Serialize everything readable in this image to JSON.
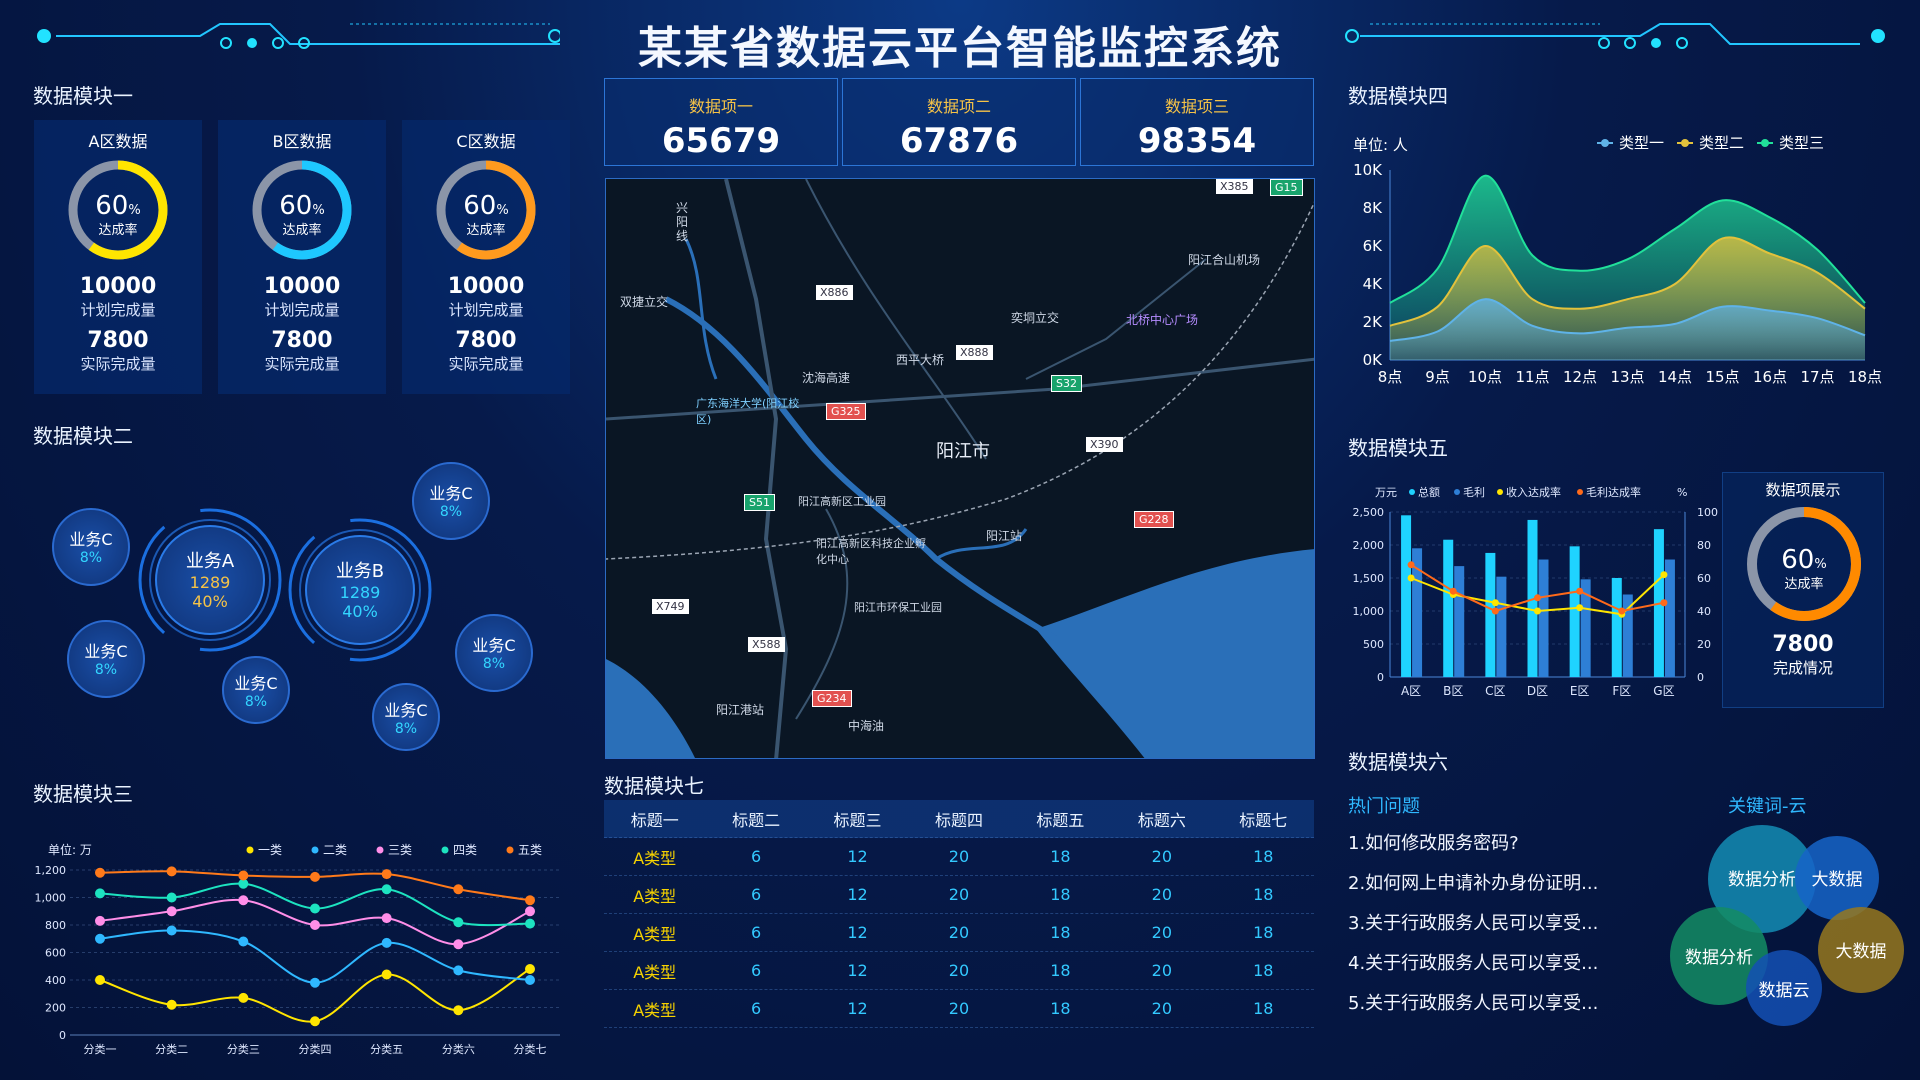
{
  "header": {
    "title": "某某省数据云平台智能监控系统",
    "kpis": [
      {
        "label": "数据项一",
        "value": "65679"
      },
      {
        "label": "数据项二",
        "value": "67876"
      },
      {
        "label": "数据项三",
        "value": "98354"
      }
    ]
  },
  "module1": {
    "title": "数据模块一",
    "cards": [
      {
        "title": "A区数据",
        "pct": "60",
        "pct_unit": "%",
        "rate_label": "达成率",
        "plan": "10000",
        "plan_label": "计划完成量",
        "actual": "7800",
        "actual_label": "实际完成量",
        "color": "#ffe500",
        "fraction": 0.6
      },
      {
        "title": "B区数据",
        "pct": "60",
        "pct_unit": "%",
        "rate_label": "达成率",
        "plan": "10000",
        "plan_label": "计划完成量",
        "actual": "7800",
        "actual_label": "实际完成量",
        "color": "#1ec8ff",
        "fraction": 0.6
      },
      {
        "title": "C区数据",
        "pct": "60",
        "pct_unit": "%",
        "rate_label": "达成率",
        "plan": "10000",
        "plan_label": "计划完成量",
        "actual": "7800",
        "actual_label": "实际完成量",
        "color": "#ff9a1e",
        "fraction": 0.6
      }
    ]
  },
  "module2": {
    "title": "数据模块二",
    "bubbles": [
      {
        "name": "业务A",
        "value": "1289",
        "pct": "40%",
        "pct_color": "#f6c347"
      },
      {
        "name": "业务B",
        "value": "1289",
        "pct": "40%",
        "pct_color": "#33d6ff"
      },
      {
        "name": "业务C",
        "pct": "8%"
      },
      {
        "name": "业务C",
        "pct": "8%"
      },
      {
        "name": "业务C",
        "pct": "8%"
      },
      {
        "name": "业务C",
        "pct": "8%"
      },
      {
        "name": "业务C",
        "pct": "8%"
      },
      {
        "name": "业务C",
        "pct": "8%"
      }
    ]
  },
  "module3": {
    "title": "数据模块三"
  },
  "module4": {
    "title": "数据模块四"
  },
  "module5": {
    "title": "数据模块五",
    "side_title": "数据项展示",
    "side_pct": "60",
    "side_pct_unit": "%",
    "side_rate_label": "达成率",
    "side_fraction": 0.6,
    "side_value": "7800",
    "side_value_label": "完成情况"
  },
  "module6": {
    "title": "数据模块六",
    "faq_title": "热门问题",
    "faqs": [
      "1.如何修改服务密码?",
      "2.如何网上申请补办身份证明...",
      "3.关于行政服务人民可以享受...",
      "4.关于行政服务人民可以享受...",
      "5.关于行政服务人民可以享受..."
    ],
    "keyword_title": "关键词-云",
    "keywords": [
      "数据分析",
      "大数据",
      "数据分析",
      "大数据",
      "数据云"
    ]
  },
  "module7": {
    "title": "数据模块七",
    "headers": [
      "标题一",
      "标题二",
      "标题三",
      "标题四",
      "标题五",
      "标题六",
      "标题七"
    ],
    "rows": [
      [
        "A类型",
        "6",
        "12",
        "20",
        "18",
        "20",
        "18"
      ],
      [
        "A类型",
        "6",
        "12",
        "20",
        "18",
        "20",
        "18"
      ],
      [
        "A类型",
        "6",
        "12",
        "20",
        "18",
        "20",
        "18"
      ],
      [
        "A类型",
        "6",
        "12",
        "20",
        "18",
        "20",
        "18"
      ],
      [
        "A类型",
        "6",
        "12",
        "20",
        "18",
        "20",
        "18"
      ]
    ]
  },
  "map": {
    "city": "阳江市",
    "labels": [
      "兴阳线",
      "沈海高速",
      "阳江合山机场",
      "北桥中心广场",
      "西平大桥",
      "阳江站",
      "阳江港站",
      "中海油",
      "奕垌立交",
      "双捷立交",
      "广东海洋大学(阳江校区)",
      "阳江高新区工业园",
      "阳江高新区科技企业孵化中心",
      "阳江市环保工业园"
    ],
    "shields": [
      "G15",
      "G325",
      "S51",
      "S32",
      "G228",
      "G234",
      "X886",
      "X888",
      "X390",
      "X749",
      "X588",
      "X385"
    ]
  },
  "chart_data": [
    {
      "type": "line",
      "chart_id": "module3",
      "unit": "单位: 万",
      "categories": [
        "分类一",
        "分类二",
        "分类三",
        "分类四",
        "分类五",
        "分类六",
        "分类七"
      ],
      "ylim": [
        0,
        1200
      ],
      "yticks": [
        "0",
        "200",
        "400",
        "600",
        "800",
        "1,000",
        "1,200"
      ],
      "series": [
        {
          "name": "一类",
          "color": "#ffe500",
          "values": [
            400,
            220,
            270,
            100,
            440,
            180,
            480
          ]
        },
        {
          "name": "二类",
          "color": "#2fb8ff",
          "values": [
            700,
            760,
            680,
            380,
            670,
            470,
            400
          ]
        },
        {
          "name": "三类",
          "color": "#ff8ee8",
          "values": [
            830,
            900,
            980,
            800,
            850,
            660,
            900
          ]
        },
        {
          "name": "四类",
          "color": "#1de3c0",
          "values": [
            1030,
            1000,
            1100,
            920,
            1060,
            820,
            810
          ]
        },
        {
          "name": "五类",
          "color": "#ff7a1a",
          "values": [
            1180,
            1190,
            1160,
            1150,
            1170,
            1060,
            980
          ]
        }
      ]
    },
    {
      "type": "area",
      "chart_id": "module4",
      "unit": "单位: 人",
      "x": [
        "8点",
        "9点",
        "10点",
        "11点",
        "12点",
        "13点",
        "14点",
        "15点",
        "16点",
        "17点",
        "18点"
      ],
      "ylim": [
        0,
        10000
      ],
      "yticks": [
        "0K",
        "2K",
        "4K",
        "6K",
        "8K",
        "10K"
      ],
      "series": [
        {
          "name": "类型一",
          "color": "#5fb3e8",
          "values": [
            1000,
            1500,
            3200,
            1800,
            1400,
            1700,
            1900,
            2800,
            2600,
            2200,
            1300
          ]
        },
        {
          "name": "类型二",
          "color": "#e2c23c",
          "values": [
            1800,
            2800,
            6000,
            3200,
            2700,
            3200,
            4000,
            6400,
            5600,
            4600,
            2700
          ]
        },
        {
          "name": "类型三",
          "color": "#21e09a",
          "values": [
            3000,
            4800,
            9700,
            5500,
            4700,
            5300,
            6900,
            8400,
            7500,
            5800,
            3000
          ]
        }
      ]
    },
    {
      "type": "bar",
      "chart_id": "module5",
      "left_unit": "万元",
      "right_unit": "%",
      "categories": [
        "A区",
        "B区",
        "C区",
        "D区",
        "E区",
        "F区",
        "G区"
      ],
      "ylim": [
        0,
        2500
      ],
      "yticks": [
        "0",
        "500",
        "1,000",
        "1,500",
        "2,000",
        "2,500"
      ],
      "y2lim": [
        0,
        100
      ],
      "y2ticks": [
        "0",
        "20",
        "40",
        "60",
        "80",
        "100"
      ],
      "series": [
        {
          "name": "总额",
          "color": "#1fd3ff",
          "kind": "bar",
          "values": [
            2450,
            2080,
            1880,
            2380,
            1980,
            1500,
            2240
          ]
        },
        {
          "name": "毛利",
          "color": "#2e7fd6",
          "kind": "bar",
          "values": [
            1950,
            1680,
            1520,
            1780,
            1480,
            1250,
            1780
          ]
        },
        {
          "name": "收入达成率",
          "color": "#ffe500",
          "kind": "line",
          "values": [
            60,
            50,
            45,
            40,
            42,
            38,
            62
          ]
        },
        {
          "name": "毛利达成率",
          "color": "#ff6a1a",
          "kind": "line",
          "values": [
            68,
            52,
            40,
            48,
            52,
            40,
            45
          ]
        }
      ]
    }
  ]
}
